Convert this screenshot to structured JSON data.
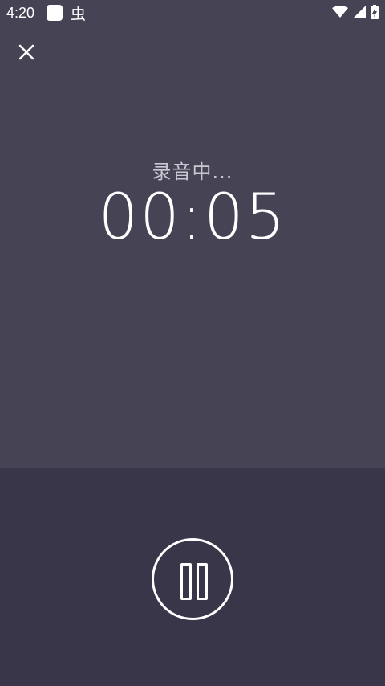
{
  "status_bar": {
    "time": "4:20",
    "notification_icons": [
      "app-square-icon",
      "bug-icon"
    ],
    "system_icons": [
      "wifi-icon",
      "signal-icon",
      "battery-charging-icon"
    ]
  },
  "toolbar": {
    "close_icon": "close-icon"
  },
  "recording": {
    "status_label": "录音中...",
    "elapsed_time": "00:05"
  },
  "controls": {
    "pause_icon": "pause-icon"
  },
  "colors": {
    "background": "#464355",
    "control_panel": "#39364a",
    "foreground": "#ffffff",
    "label": "#c9c7d2"
  }
}
